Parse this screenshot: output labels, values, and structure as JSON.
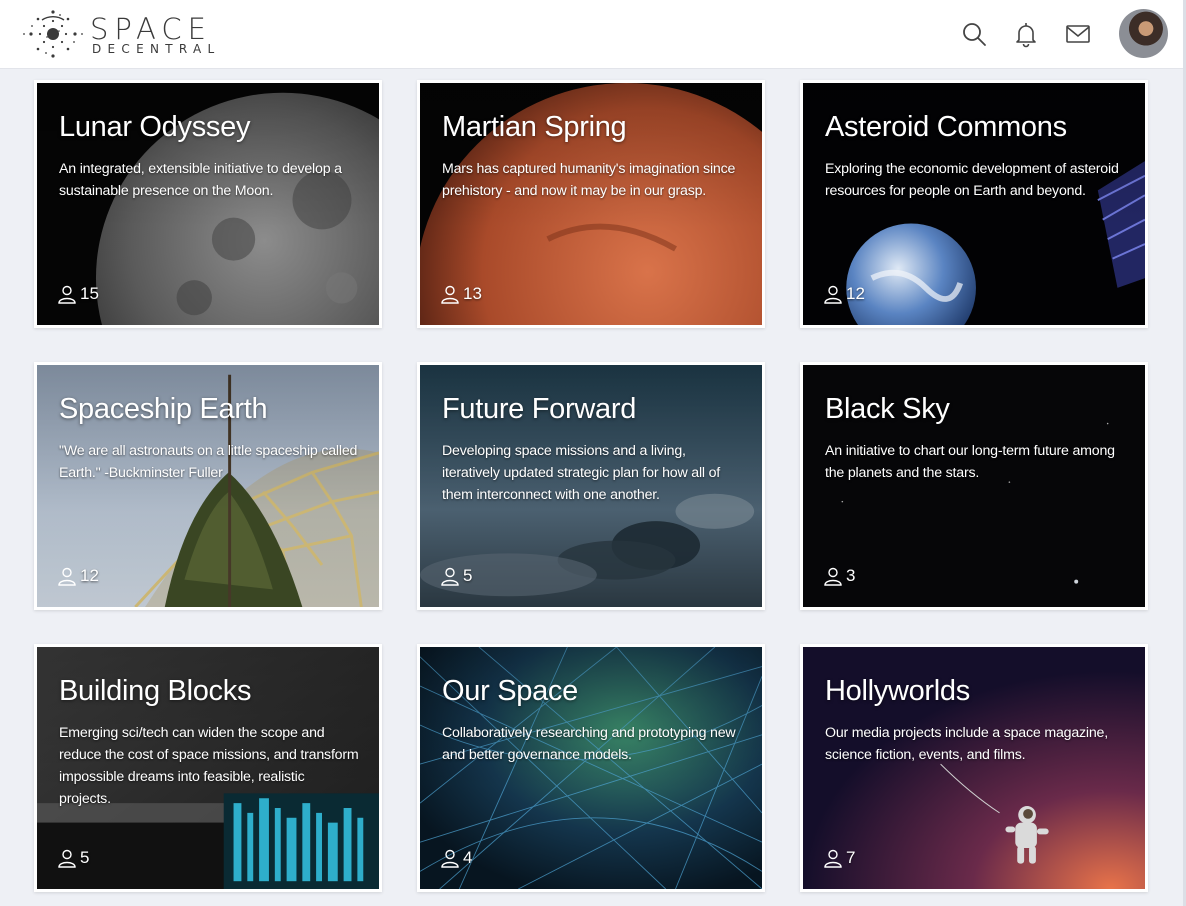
{
  "brand": {
    "wordmark_top": "SPACE",
    "wordmark_bottom": "DECENTRAL"
  },
  "header": {
    "icons": [
      "search-icon",
      "bell-icon",
      "mail-icon"
    ],
    "avatar": "user-avatar"
  },
  "projects": [
    {
      "title": "Lunar Odyssey",
      "description": "An integrated, extensible initiative to develop a sustainable presence on the Moon.",
      "members": "15"
    },
    {
      "title": "Martian Spring",
      "description": "Mars has captured humanity's imagination since prehistory - and now it may be in our grasp.",
      "members": "13"
    },
    {
      "title": "Asteroid Commons",
      "description": "Exploring the economic development of asteroid resources for people on Earth and beyond.",
      "members": "12"
    },
    {
      "title": "Spaceship Earth",
      "description": "\"We are all astronauts on a little spaceship called Earth.\" -Buckminster Fuller",
      "members": "12"
    },
    {
      "title": "Future Forward",
      "description": "Developing space missions and a living, iteratively updated strategic plan for how all of them interconnect with one another.",
      "members": "5"
    },
    {
      "title": "Black Sky",
      "description": "An initiative to chart our long-term future among the planets and the stars.",
      "members": "3"
    },
    {
      "title": "Building Blocks",
      "description": "Emerging sci/tech can widen the scope and reduce the cost of space missions, and transform impossible dreams into feasible, realistic projects.",
      "members": "5"
    },
    {
      "title": "Our Space",
      "description": "Collaboratively researching and prototyping new and better governance models.",
      "members": "4"
    },
    {
      "title": "Hollyworlds",
      "description": "Our media projects include a space magazine, science fiction, events, and films.",
      "members": "7"
    }
  ],
  "colors": {
    "page_background": "#eef0f5",
    "header_background": "#ffffff",
    "card_border": "#ffffff",
    "text_on_card": "#ffffff"
  }
}
